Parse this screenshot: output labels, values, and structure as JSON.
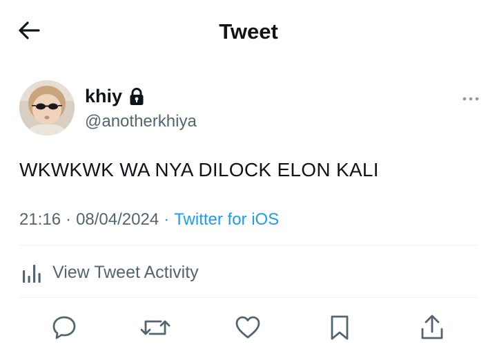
{
  "header": {
    "title": "Tweet",
    "back_icon": "arrow-left-icon"
  },
  "tweet": {
    "author": {
      "name": "khiy",
      "handle": "@anotherkhiya",
      "protected_icon": "lock-icon"
    },
    "text": "WKWKWK WA NYA DILOCK ELON KALI",
    "time": "21:16",
    "separator": "·",
    "date": "08/04/2024",
    "source": "Twitter for iOS"
  },
  "activity": {
    "label": "View Tweet Activity",
    "icon": "bar-chart-icon"
  },
  "actions": [
    {
      "name": "reply",
      "icon": "reply-icon"
    },
    {
      "name": "retweet",
      "icon": "retweet-icon"
    },
    {
      "name": "like",
      "icon": "heart-icon"
    },
    {
      "name": "bookmark",
      "icon": "bookmark-icon"
    },
    {
      "name": "share",
      "icon": "share-icon"
    }
  ],
  "colors": {
    "text_primary": "#0f1419",
    "text_secondary": "#536471",
    "link": "#1d9bf0",
    "divider": "#eff3f4"
  }
}
